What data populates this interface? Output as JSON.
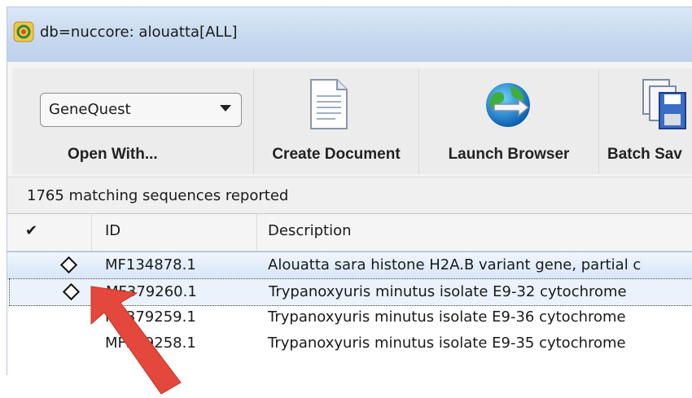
{
  "window": {
    "title": "db=nuccore: alouatta[ALL]"
  },
  "toolbar": {
    "open_with": {
      "selected": "GeneQuest",
      "label": "Open With..."
    },
    "create_document": {
      "label": "Create Document"
    },
    "launch_browser": {
      "label": "Launch Browser"
    },
    "batch_save": {
      "label": "Batch Sav"
    }
  },
  "status": {
    "text": "1765 matching sequences reported"
  },
  "table": {
    "columns": {
      "check": "✔",
      "id": "ID",
      "description": "Description"
    },
    "rows": [
      {
        "id": "MF134878.1",
        "description": "Alouatta sara histone H2A.B variant gene, partial c"
      },
      {
        "id": "MF379260.1",
        "description": "Trypanoxyuris minutus isolate E9-32 cytochrome"
      },
      {
        "id": "MF379259.1",
        "description": "Trypanoxyuris minutus isolate E9-36 cytochrome"
      },
      {
        "id": "MF379258.1",
        "description": "Trypanoxyuris minutus isolate E9-35 cytochrome"
      }
    ]
  },
  "colors": {
    "accent": "#e4473b",
    "titlebar": "#c7d9ee",
    "selection": "#d7e6f8"
  },
  "icons": [
    "app-icon",
    "document-icon",
    "globe-icon",
    "batch-save-icon",
    "diamond-marker-icon",
    "red-arrow-annotation"
  ]
}
